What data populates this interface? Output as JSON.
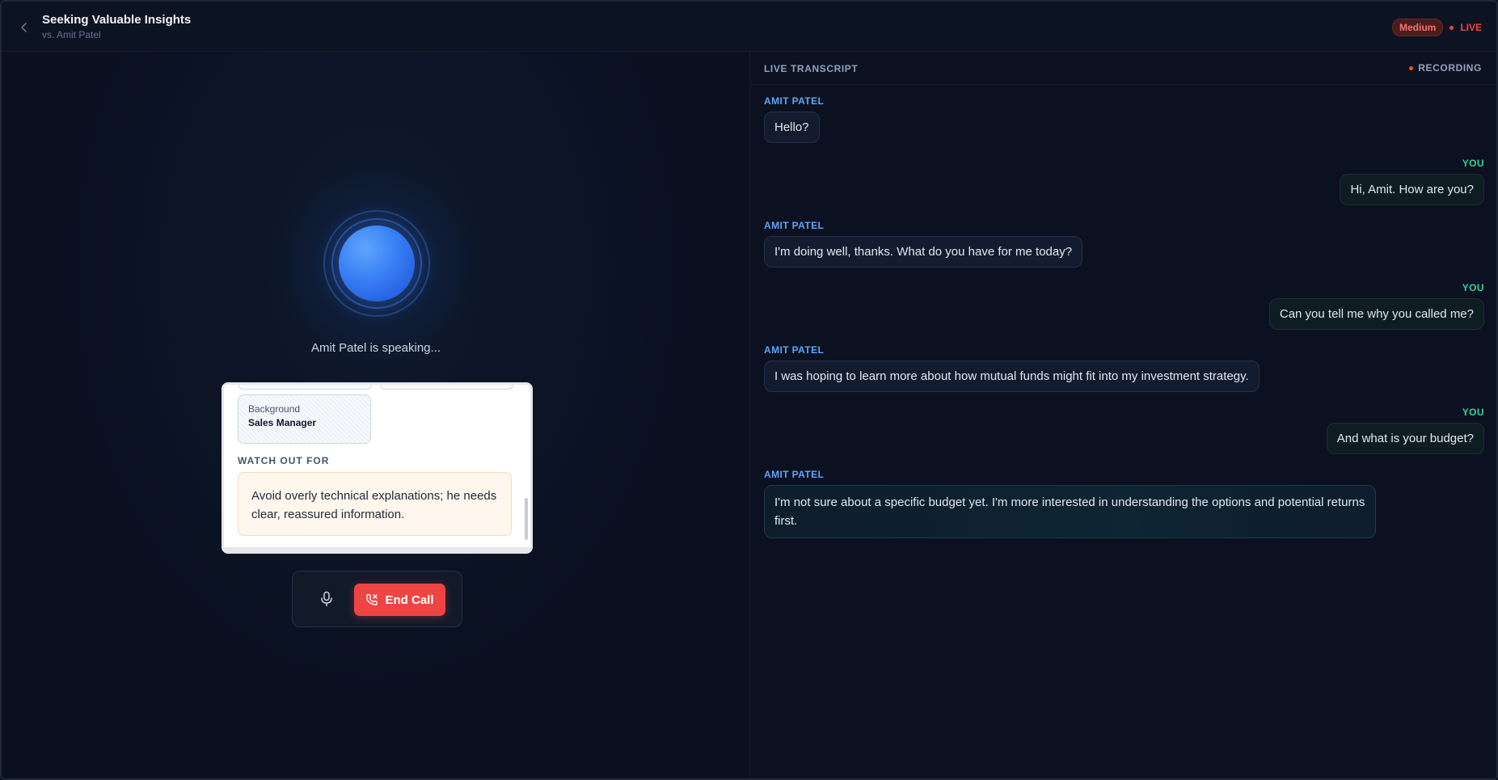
{
  "header": {
    "title": "Seeking Valuable Insights",
    "subtitle": "vs. Amit Patel",
    "difficulty": "Medium",
    "live_label": "LIVE"
  },
  "voice": {
    "speaking_label": "Amit Patel is speaking..."
  },
  "persona_card": {
    "background_label": "Background",
    "background_value": "Sales Manager",
    "watch_heading": "WATCH OUT FOR",
    "watch_text": "Avoid overly technical explanations; he needs clear, reassured information."
  },
  "controls": {
    "end_call_label": "End Call"
  },
  "transcript": {
    "title": "LIVE TRANSCRIPT",
    "recording_label": "RECORDING",
    "messages": [
      {
        "speaker": "AMIT PATEL",
        "text": "Hello?"
      },
      {
        "speaker": "YOU",
        "text": "Hi, Amit. How are you?"
      },
      {
        "speaker": "AMIT PATEL",
        "text": "I'm doing well, thanks. What do you have for me today?"
      },
      {
        "speaker": "YOU",
        "text": "Can you tell me why you called me?"
      },
      {
        "speaker": "AMIT PATEL",
        "text": "I was hoping to learn more about how mutual funds might fit into my investment strategy."
      },
      {
        "speaker": "YOU",
        "text": "And what is your budget?"
      },
      {
        "speaker": "AMIT PATEL",
        "text": "I'm not sure about a specific budget yet. I'm more interested in understanding the options and potential returns first."
      }
    ]
  },
  "colors": {
    "background": "#0b1120",
    "accent_blue": "#3b82f6",
    "speaker_them": "#60a5fa",
    "speaker_you": "#34d399",
    "end_call": "#ef4444",
    "live_red": "#ef4444"
  },
  "icons": {
    "back": "chevron-left-icon",
    "mic": "microphone-icon",
    "end_call": "phone-hangup-icon"
  }
}
